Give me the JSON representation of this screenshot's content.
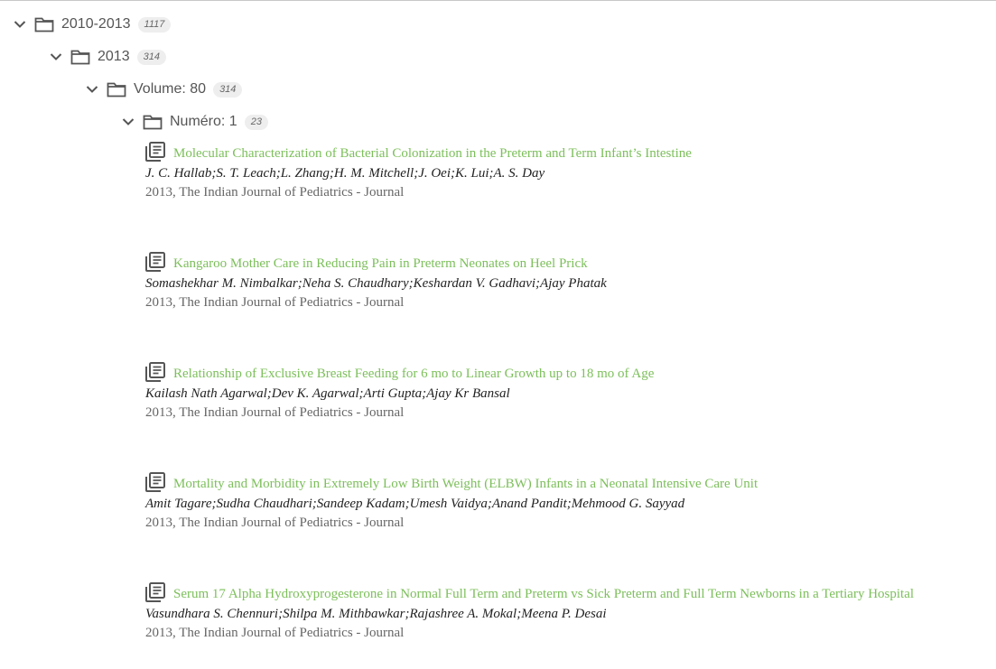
{
  "tree": {
    "level0": {
      "label": "2010-2013",
      "count": "1117"
    },
    "level1": {
      "label": "2013",
      "count": "314"
    },
    "level2": {
      "label": "Volume: 80",
      "count": "314"
    },
    "level3": {
      "label": "Numéro: 1",
      "count": "23"
    }
  },
  "articles": [
    {
      "title": "Molecular Characterization of Bacterial Colonization in the Preterm and Term Infant’s Intestine",
      "authors": "J. C. Hallab;S. T. Leach;L. Zhang;H. M. Mitchell;J. Oei;K. Lui;A. S. Day",
      "source": "2013, The Indian Journal of Pediatrics - Journal"
    },
    {
      "title": "Kangaroo Mother Care in Reducing Pain in Preterm Neonates on Heel Prick",
      "authors": "Somashekhar M. Nimbalkar;Neha S. Chaudhary;Keshardan V. Gadhavi;Ajay Phatak",
      "source": "2013, The Indian Journal of Pediatrics - Journal"
    },
    {
      "title": "Relationship of Exclusive Breast Feeding for 6 mo to Linear Growth up to 18 mo of Age",
      "authors": "Kailash Nath Agarwal;Dev K. Agarwal;Arti Gupta;Ajay Kr Bansal",
      "source": "2013, The Indian Journal of Pediatrics - Journal"
    },
    {
      "title": "Mortality and Morbidity in Extremely Low Birth Weight (ELBW) Infants in a Neonatal Intensive Care Unit",
      "authors": "Amit Tagare;Sudha Chaudhari;Sandeep Kadam;Umesh Vaidya;Anand Pandit;Mehmood G. Sayyad",
      "source": "2013, The Indian Journal of Pediatrics - Journal"
    },
    {
      "title": "Serum 17 Alpha Hydroxyprogesterone in Normal Full Term and Preterm vs Sick Preterm and Full Term Newborns in a Tertiary Hospital",
      "authors": "Vasundhara S. Chennuri;Shilpa M. Mithbawkar;Rajashree A. Mokal;Meena P. Desai",
      "source": "2013, The Indian Journal of Pediatrics - Journal"
    }
  ],
  "colors": {
    "title_link": "#7cbf5a",
    "tree_text": "#555555",
    "icon": "#555555",
    "badge_bg": "#eeeeee"
  },
  "icons": {
    "expand": "chevron-down-icon",
    "folder": "folder-icon",
    "article": "library-books-icon"
  }
}
